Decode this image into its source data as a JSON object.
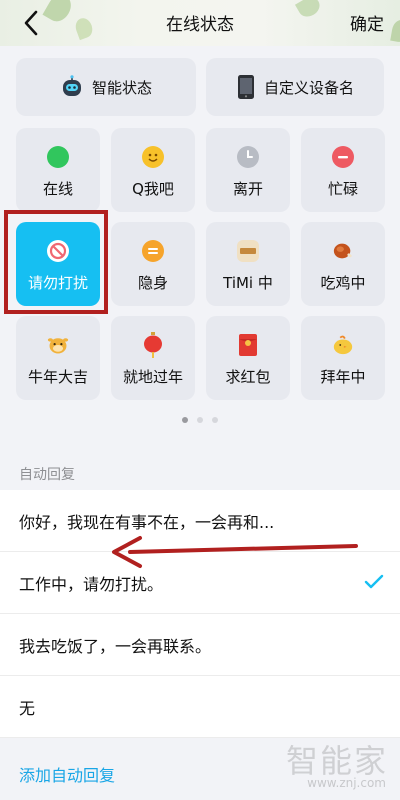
{
  "header": {
    "title": "在线状态",
    "confirm": "确定"
  },
  "top_buttons": [
    {
      "label": "智能状态",
      "icon": "robot-icon"
    },
    {
      "label": "自定义设备名",
      "icon": "phone-icon"
    }
  ],
  "status_tiles": [
    {
      "label": "在线",
      "icon": "green-dot-icon",
      "color": "#31c65d"
    },
    {
      "label": "Q我吧",
      "icon": "smiley-icon",
      "color": "#f7c12a"
    },
    {
      "label": "离开",
      "icon": "clock-icon",
      "color": "#b8bcc4"
    },
    {
      "label": "忙碌",
      "icon": "minus-circle-icon",
      "color": "#ee5a62"
    },
    {
      "label": "请勿打扰",
      "icon": "no-entry-icon",
      "color": "#ffffff",
      "selected": true
    },
    {
      "label": "隐身",
      "icon": "equals-circle-icon",
      "color": "#f6a42b"
    },
    {
      "label": "TiMi 中",
      "icon": "timi-icon",
      "color": "#f0e0c3"
    },
    {
      "label": "吃鸡中",
      "icon": "chicken-drumstick-icon",
      "color": "#c4531c"
    },
    {
      "label": "牛年大吉",
      "icon": "ox-icon",
      "color": "#f1b23c"
    },
    {
      "label": "就地过年",
      "icon": "lantern-icon",
      "color": "#e63a33"
    },
    {
      "label": "求红包",
      "icon": "red-envelope-icon",
      "color": "#e23a32"
    },
    {
      "label": "拜年中",
      "icon": "chick-icon",
      "color": "#f5c83e"
    }
  ],
  "pager": {
    "pages": 3,
    "current": 1
  },
  "auto_reply": {
    "section_label": "自动回复",
    "items": [
      {
        "text": "你好，我现在有事不在，一会再和...",
        "checked": false
      },
      {
        "text": "工作中，请勿打扰。",
        "checked": true
      },
      {
        "text": "我去吃饭了，一会再联系。",
        "checked": false
      },
      {
        "text": "无",
        "checked": false
      }
    ],
    "add_label": "添加自动回复"
  },
  "watermark": {
    "logo": "智能家",
    "url": "www.znj.com"
  },
  "colors": {
    "accent": "#16bff2",
    "link": "#19a6e6",
    "annotation": "#b1201f"
  }
}
